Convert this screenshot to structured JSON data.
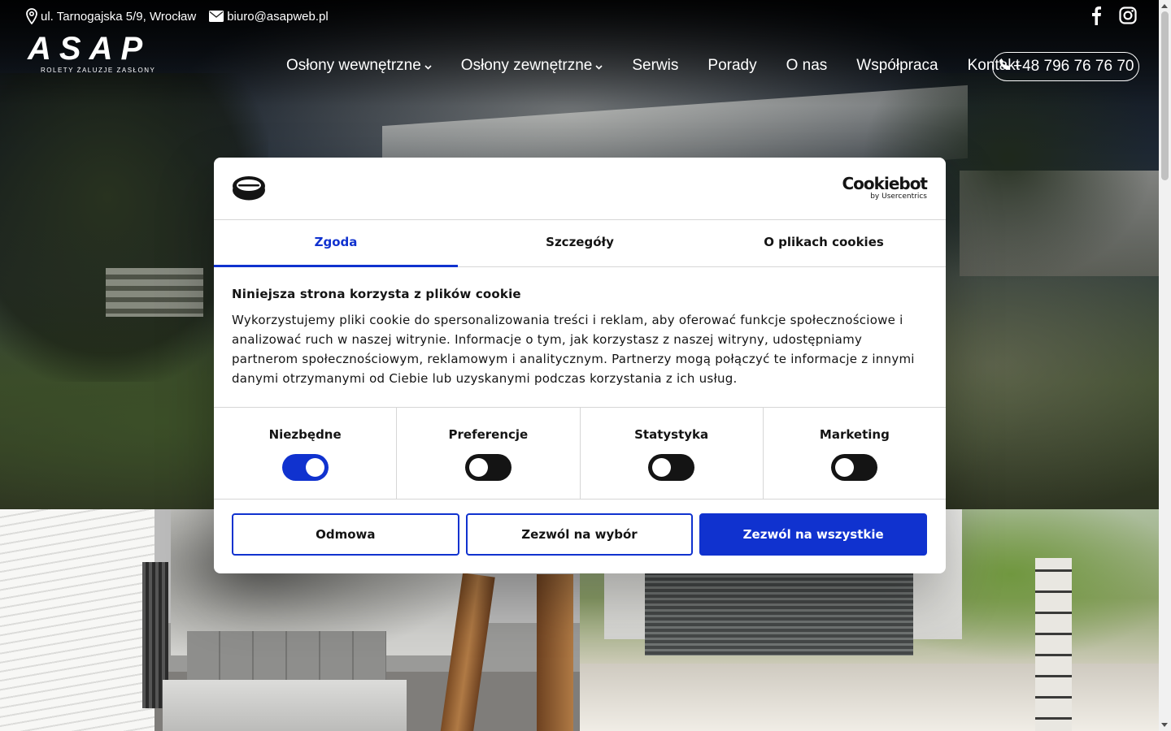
{
  "topbar": {
    "address": "ul. Tarnogajska 5/9, Wrocław",
    "email": "biuro@asapweb.pl"
  },
  "social": {
    "facebook_icon": "facebook-icon",
    "instagram_icon": "instagram-icon"
  },
  "logo": {
    "mark": "ASAP",
    "tagline": "ROLETY ŻALUZJE ZASŁONY"
  },
  "nav": {
    "items": [
      {
        "label": "Osłony wewnętrzne",
        "has_dropdown": true
      },
      {
        "label": "Osłony zewnętrzne",
        "has_dropdown": true
      },
      {
        "label": "Serwis"
      },
      {
        "label": "Porady"
      },
      {
        "label": "O nas"
      },
      {
        "label": "Współpraca"
      },
      {
        "label": "Kontakt"
      }
    ],
    "phone": "+48 796 76 76 70"
  },
  "cookie_dialog": {
    "brand": "Cookiebot",
    "brand_sub": "by Usercentrics",
    "tabs": [
      "Zgoda",
      "Szczegóły",
      "O plikach cookies"
    ],
    "active_tab": "Zgoda",
    "heading": "Niniejsza strona korzysta z plików cookie",
    "text": "Wykorzystujemy pliki cookie do spersonalizowania treści i reklam, aby oferować funkcje społecznościowe i analizować ruch w naszej witrynie. Informacje o tym, jak korzystasz z naszej witryny, udostępniamy partnerom społecznościowym, reklamowym i analitycznym. Partnerzy mogą połączyć te informacje z innymi danymi otrzymanymi od Ciebie lub uzyskanymi podczas korzystania z ich usług.",
    "categories": [
      {
        "label": "Niezbędne",
        "enabled": true
      },
      {
        "label": "Preferencje",
        "enabled": false
      },
      {
        "label": "Statystyka",
        "enabled": false
      },
      {
        "label": "Marketing",
        "enabled": false
      }
    ],
    "buttons": {
      "deny": "Odmowa",
      "allow_selection": "Zezwól na wybór",
      "allow_all": "Zezwól na wszystkie"
    }
  },
  "colors": {
    "accent": "#1032cf",
    "text": "#141414",
    "white": "#ffffff"
  }
}
